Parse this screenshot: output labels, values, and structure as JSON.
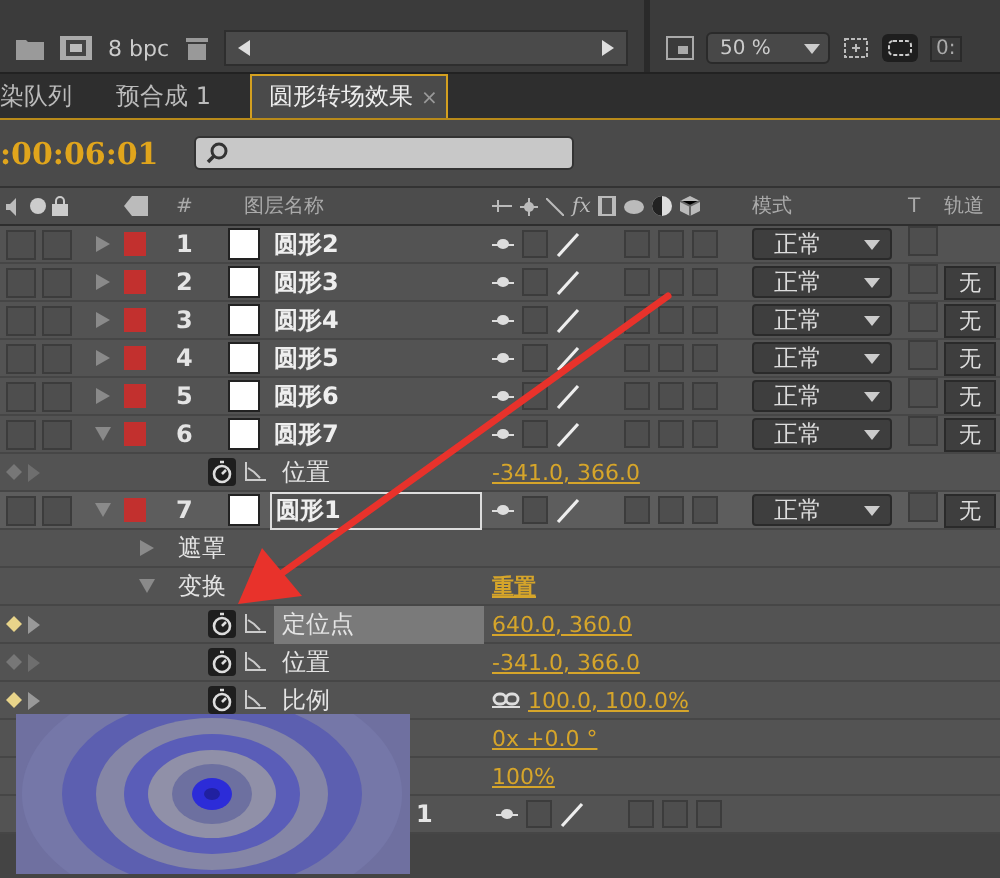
{
  "toolbar": {
    "depth": "8 bpc"
  },
  "viewer": {
    "zoom": "50 %",
    "time": "0:"
  },
  "tabs": [
    {
      "label": "染队列",
      "selected": false
    },
    {
      "label": "预合成 1",
      "selected": false
    },
    {
      "label": "圆形转场效果",
      "selected": true,
      "close": "×"
    }
  ],
  "timecode": ":00:06:01",
  "columns": {
    "effects": "fx",
    "number": "#",
    "name": "图层名称",
    "mode": "模式",
    "t": "T",
    "track": "轨道"
  },
  "rows": [
    {
      "kind": "layer",
      "number": "1",
      "name": "圆形2",
      "expanded": false,
      "selected": false,
      "mode": "正常"
    },
    {
      "kind": "layer",
      "number": "2",
      "name": "圆形3",
      "expanded": false,
      "selected": false,
      "mode": "正常",
      "track": "无"
    },
    {
      "kind": "layer",
      "number": "3",
      "name": "圆形4",
      "expanded": false,
      "selected": false,
      "mode": "正常",
      "track": "无"
    },
    {
      "kind": "layer",
      "number": "4",
      "name": "圆形5",
      "expanded": false,
      "selected": false,
      "mode": "正常",
      "track": "无"
    },
    {
      "kind": "layer",
      "number": "5",
      "name": "圆形6",
      "expanded": false,
      "selected": false,
      "mode": "正常",
      "track": "无"
    },
    {
      "kind": "layer",
      "number": "6",
      "name": "圆形7",
      "expanded": true,
      "selected": false,
      "mode": "正常",
      "track": "无",
      "children": [
        {
          "kind": "property",
          "name": "位置",
          "value": "-341.0, 366.0",
          "keyframed": false,
          "selected": false
        }
      ]
    },
    {
      "kind": "layer",
      "number": "7",
      "name": "圆形1",
      "expanded": true,
      "selected": true,
      "mode": "正常",
      "track": "无",
      "children": [
        {
          "kind": "group",
          "name": "遮罩",
          "expanded": false
        },
        {
          "kind": "group",
          "name": "变换",
          "expanded": true,
          "value": "重置",
          "children": [
            {
              "kind": "property",
              "name": "定位点",
              "value": "640.0, 360.0",
              "keyframed": true,
              "selected": true
            },
            {
              "kind": "property",
              "name": "位置",
              "value": "-341.0, 366.0",
              "keyframed": false,
              "selected": false
            },
            {
              "kind": "property",
              "name": "比例",
              "value": "100.0, 100.0%",
              "keyframed": true,
              "selected": false,
              "linked": true
            },
            {
              "kind": "property",
              "value": "0x +0.0 °"
            },
            {
              "kind": "property",
              "value": "100%"
            }
          ]
        }
      ]
    },
    {
      "kind": "covered",
      "name": "1"
    }
  ]
}
